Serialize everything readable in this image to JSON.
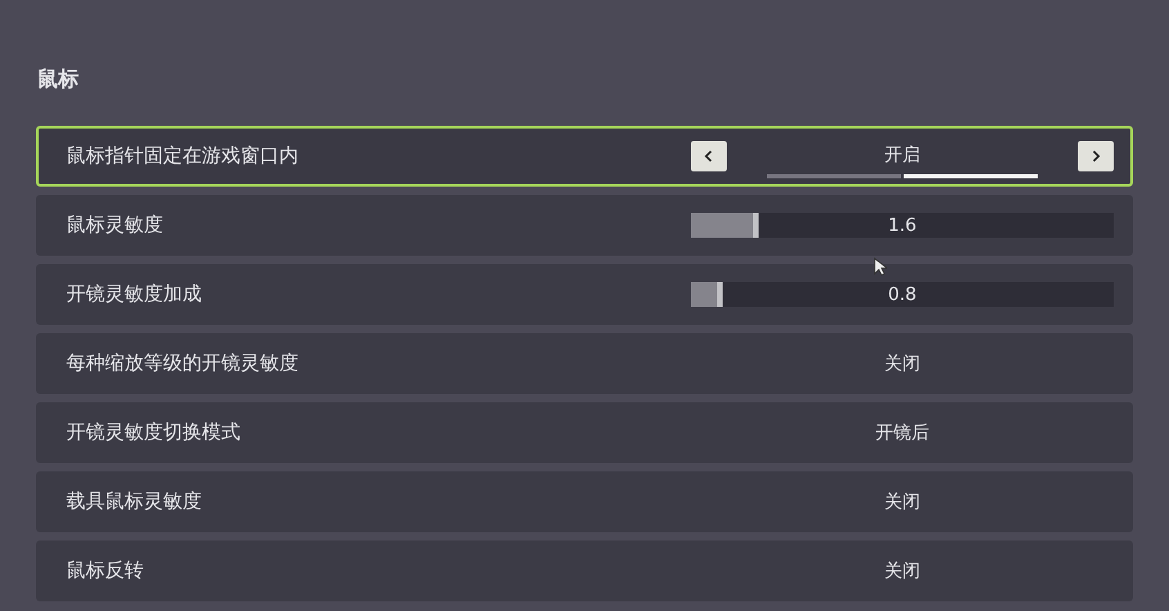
{
  "section": {
    "title": "鼠标"
  },
  "rows": [
    {
      "label": "鼠标指针固定在游戏窗口内",
      "kind": "toggle",
      "value": "开启",
      "selected": true,
      "segments": [
        {
          "selected": false
        },
        {
          "selected": true
        }
      ]
    },
    {
      "label": "鼠标灵敏度",
      "kind": "slider",
      "value": "1.6",
      "level": 0.16,
      "selected": false
    },
    {
      "label": "开镜灵敏度加成",
      "kind": "slider",
      "value": "0.8",
      "level": 0.075,
      "selected": false
    },
    {
      "label": "每种缩放等级的开镜灵敏度",
      "kind": "option",
      "value": "关闭",
      "selected": false
    },
    {
      "label": "开镜灵敏度切换模式",
      "kind": "option",
      "value": "开镜后",
      "selected": false
    },
    {
      "label": "载具鼠标灵敏度",
      "kind": "option",
      "value": "关闭",
      "selected": false
    },
    {
      "label": "鼠标反转",
      "kind": "option",
      "value": "关闭",
      "selected": false
    }
  ]
}
